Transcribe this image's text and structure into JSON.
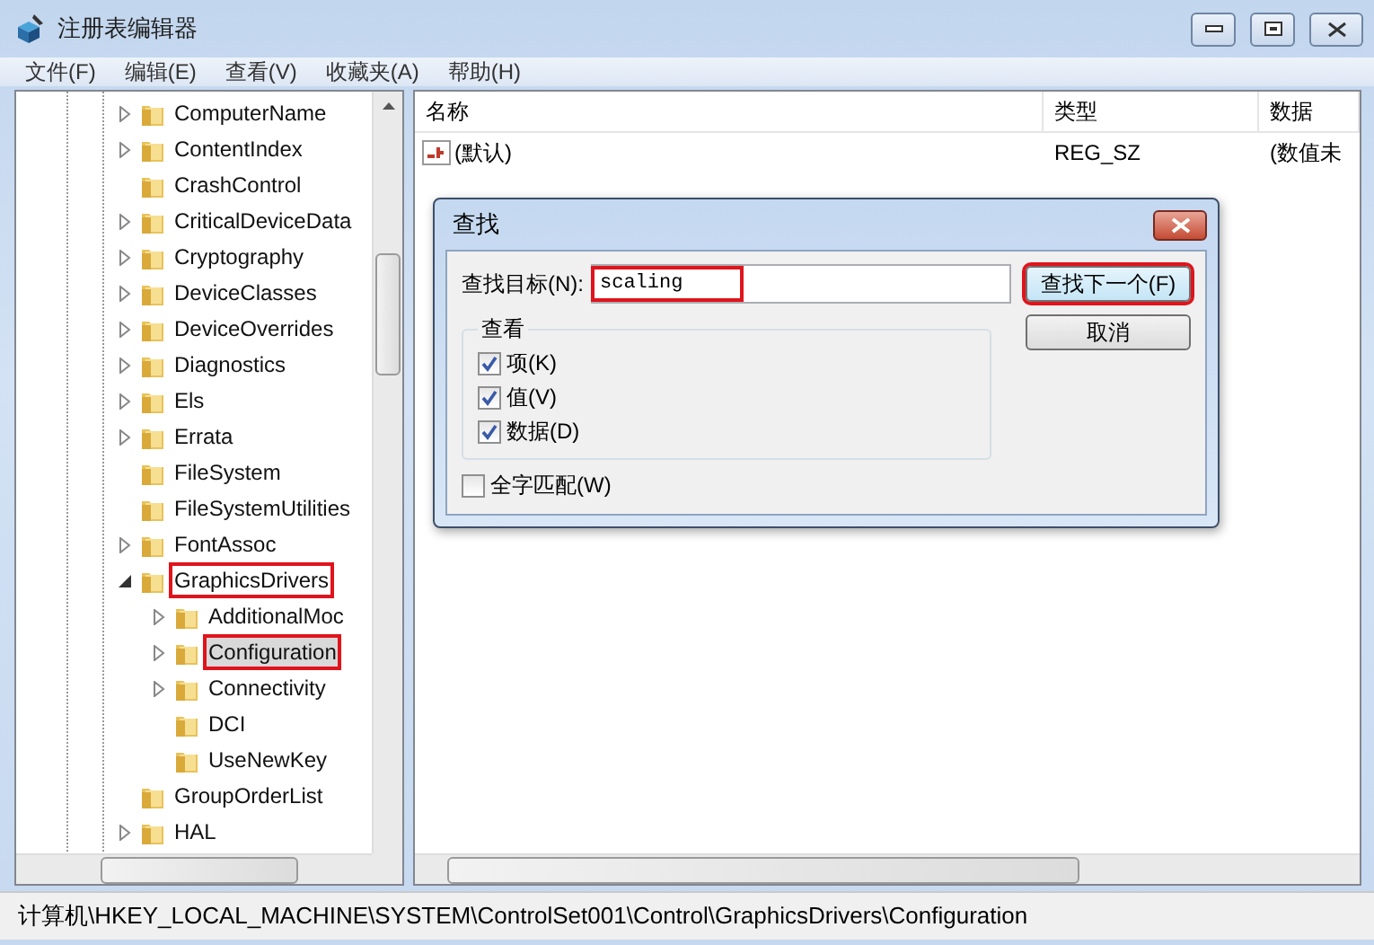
{
  "window": {
    "title": "注册表编辑器"
  },
  "menu": [
    "文件(F)",
    "编辑(E)",
    "查看(V)",
    "收藏夹(A)",
    "帮助(H)"
  ],
  "tree": {
    "items": [
      {
        "label": "ComputerName",
        "expandable": true,
        "expanded": false,
        "selected": false,
        "highlighted": false
      },
      {
        "label": "ContentIndex",
        "expandable": true,
        "expanded": false,
        "selected": false,
        "highlighted": false
      },
      {
        "label": "CrashControl",
        "expandable": false,
        "selected": false,
        "highlighted": false
      },
      {
        "label": "CriticalDeviceData",
        "expandable": true,
        "expanded": false,
        "selected": false,
        "highlighted": false
      },
      {
        "label": "Cryptography",
        "expandable": true,
        "expanded": false,
        "selected": false,
        "highlighted": false
      },
      {
        "label": "DeviceClasses",
        "expandable": true,
        "expanded": false,
        "selected": false,
        "highlighted": false
      },
      {
        "label": "DeviceOverrides",
        "expandable": true,
        "expanded": false,
        "selected": false,
        "highlighted": false
      },
      {
        "label": "Diagnostics",
        "expandable": true,
        "expanded": false,
        "selected": false,
        "highlighted": false
      },
      {
        "label": "Els",
        "expandable": true,
        "expanded": false,
        "selected": false,
        "highlighted": false
      },
      {
        "label": "Errata",
        "expandable": true,
        "expanded": false,
        "selected": false,
        "highlighted": false
      },
      {
        "label": "FileSystem",
        "expandable": false,
        "selected": false,
        "highlighted": false
      },
      {
        "label": "FileSystemUtilities",
        "expandable": false,
        "selected": false,
        "highlighted": false
      },
      {
        "label": "FontAssoc",
        "expandable": true,
        "expanded": false,
        "selected": false,
        "highlighted": false
      },
      {
        "label": "GraphicsDrivers",
        "expandable": true,
        "expanded": true,
        "selected": false,
        "highlighted": true,
        "children": [
          {
            "label": "AdditionalMoc",
            "expandable": true,
            "expanded": false,
            "selected": false,
            "highlighted": false
          },
          {
            "label": "Configuration",
            "expandable": true,
            "expanded": false,
            "selected": true,
            "highlighted": true
          },
          {
            "label": "Connectivity",
            "expandable": true,
            "expanded": false,
            "selected": false,
            "highlighted": false
          },
          {
            "label": "DCI",
            "expandable": false,
            "selected": false,
            "highlighted": false
          },
          {
            "label": "UseNewKey",
            "expandable": false,
            "selected": false,
            "highlighted": false
          }
        ]
      },
      {
        "label": "GroupOrderList",
        "expandable": false,
        "selected": false,
        "highlighted": false
      },
      {
        "label": "HAL",
        "expandable": true,
        "expanded": false,
        "selected": false,
        "highlighted": false
      }
    ]
  },
  "values": {
    "columns": [
      "名称",
      "类型",
      "数据"
    ],
    "rows": [
      {
        "name": "(默认)",
        "type": "REG_SZ",
        "data": "(数值未"
      }
    ]
  },
  "find_dialog": {
    "title": "查找",
    "target_label": "查找目标(N):",
    "target_value": "scaling",
    "target_highlighted": true,
    "find_next": {
      "label": "查找下一个(F)",
      "highlighted": true
    },
    "cancel": {
      "label": "取消",
      "highlighted": false
    },
    "look_at": {
      "title": "查看",
      "options": [
        {
          "label": "项(K)",
          "checked": true
        },
        {
          "label": "值(V)",
          "checked": true
        },
        {
          "label": "数据(D)",
          "checked": true
        }
      ]
    },
    "whole_word": {
      "label": "全字匹配(W)",
      "checked": false
    }
  },
  "status_bar": "计算机\\HKEY_LOCAL_MACHINE\\SYSTEM\\ControlSet001\\Control\\GraphicsDrivers\\Configuration"
}
